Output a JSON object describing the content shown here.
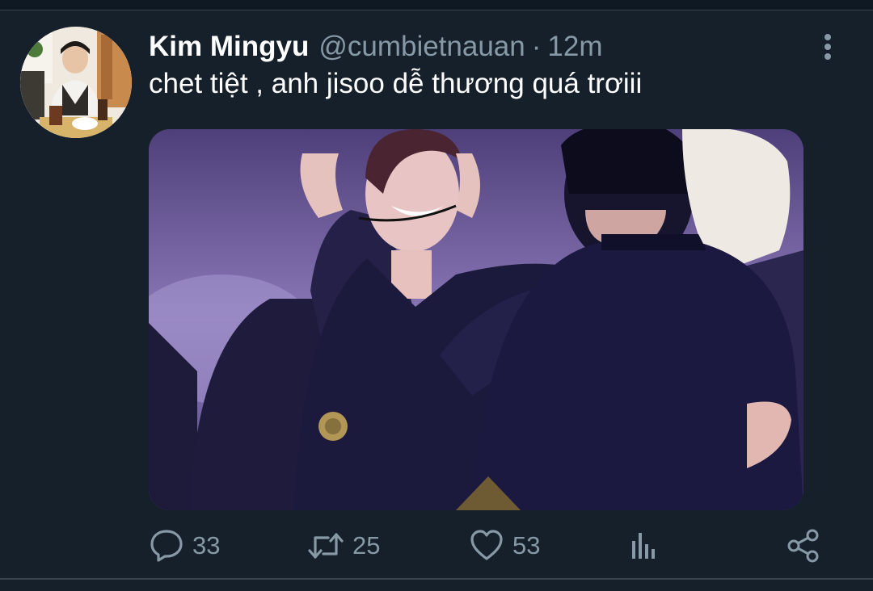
{
  "tweet": {
    "author_name": "Kim Mingyu",
    "handle": "@cumbietnauan",
    "separator": "·",
    "time": "12m",
    "text": "chet tiệt , anh jisoo dễ thương quá trơiii"
  },
  "actions": {
    "reply_count": "33",
    "retweet_count": "25",
    "like_count": "53"
  },
  "icons": {
    "more": "more-vertical-icon",
    "reply": "reply-icon",
    "retweet": "retweet-icon",
    "like": "heart-icon",
    "analytics": "analytics-icon",
    "share": "share-icon"
  },
  "colors": {
    "background": "#15202b",
    "secondary_text": "#8899a6",
    "primary_text": "#ffffff",
    "divider": "#38444d"
  }
}
